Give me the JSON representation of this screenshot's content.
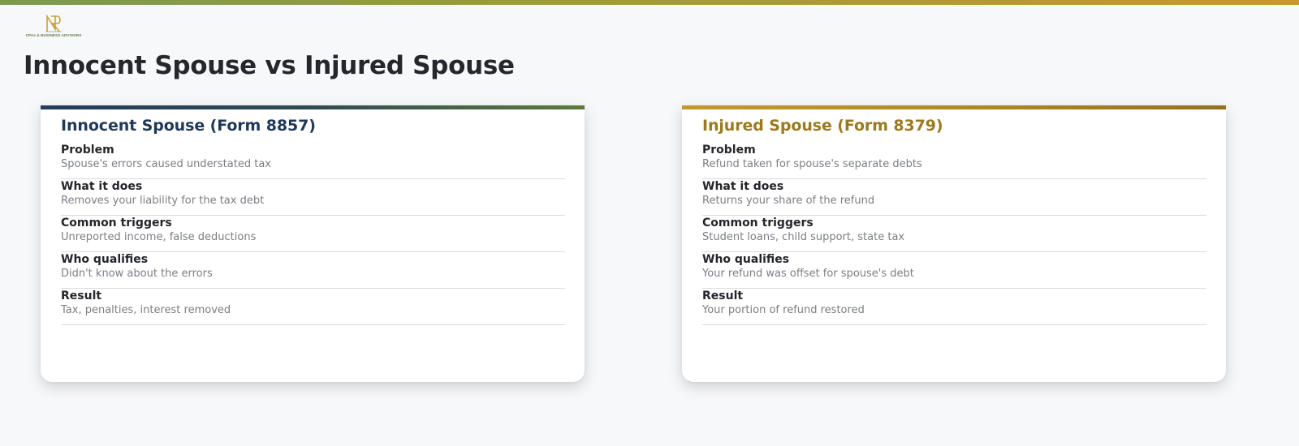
{
  "logo": {
    "text": "CPAs & BUSINESS ADVISORS",
    "colors": {
      "gold": "#c9a23a",
      "green": "#5f7d3f"
    }
  },
  "page": {
    "title": "Innocent Spouse vs Injured Spouse"
  },
  "cards": [
    {
      "title": "Innocent Spouse (Form 8857)",
      "accent": "#1f3858",
      "rows": [
        {
          "label": "Problem",
          "value": "Spouse's errors caused understated tax"
        },
        {
          "label": "What it does",
          "value": "Removes your liability for the tax debt"
        },
        {
          "label": "Common triggers",
          "value": "Unreported income, false deductions"
        },
        {
          "label": "Who qualifies",
          "value": "Didn't know about the errors"
        },
        {
          "label": "Result",
          "value": "Tax, penalties, interest removed"
        }
      ]
    },
    {
      "title": "Injured Spouse (Form 8379)",
      "accent": "#9a7a1f",
      "rows": [
        {
          "label": "Problem",
          "value": "Refund taken for spouse's separate debts"
        },
        {
          "label": "What it does",
          "value": "Returns your share of the refund"
        },
        {
          "label": "Common triggers",
          "value": "Student loans, child support, state tax"
        },
        {
          "label": "Who qualifies",
          "value": "Your refund was offset for spouse's debt"
        },
        {
          "label": "Result",
          "value": "Your portion of refund restored"
        }
      ]
    }
  ]
}
